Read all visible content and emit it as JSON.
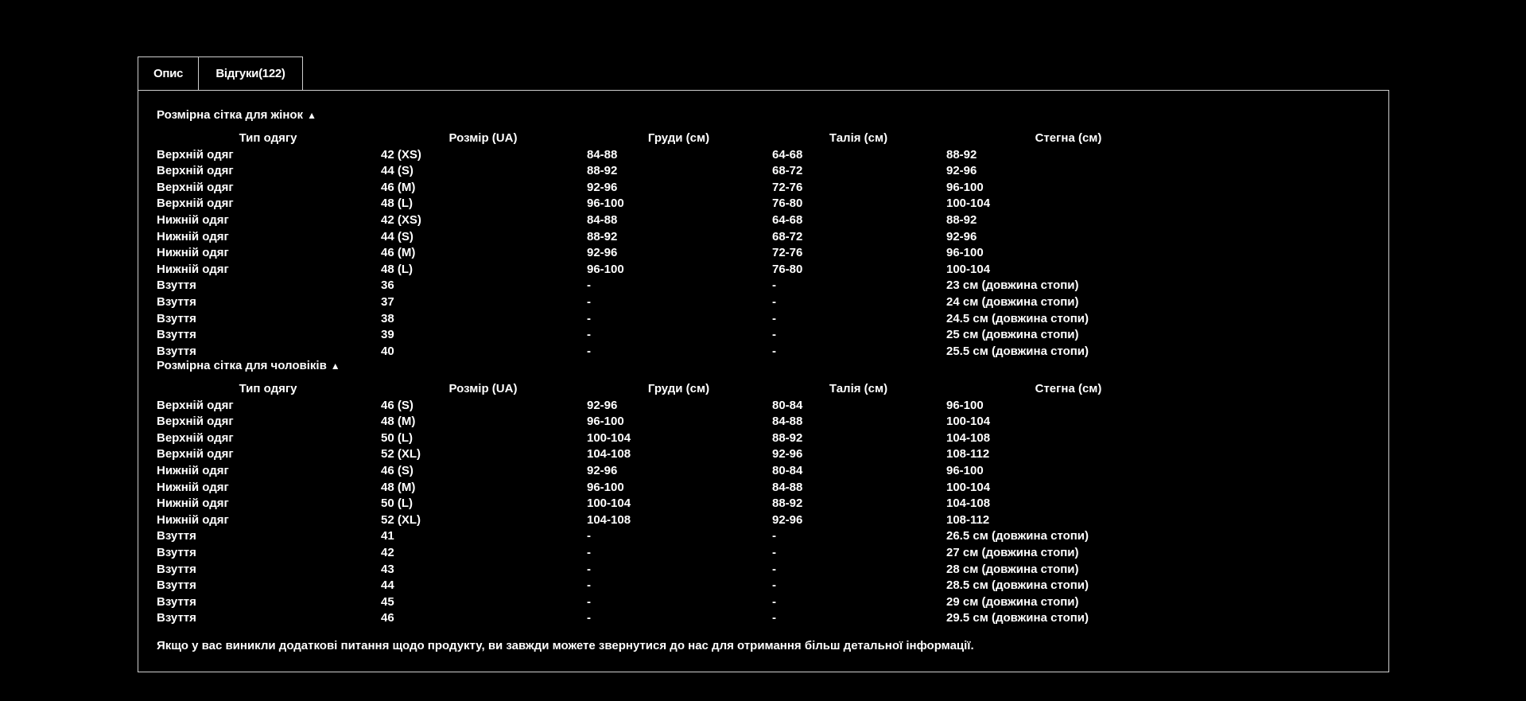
{
  "tabs": [
    {
      "label": "Опис"
    },
    {
      "label": "Відгуки(122)"
    }
  ],
  "women": {
    "title": "Розмірна сітка для жінок",
    "arrow": "▲",
    "headers": [
      "Тип одягу",
      "Розмір (UA)",
      "Груди (см)",
      "Талія (см)",
      "Стегна (см)"
    ],
    "rows": [
      [
        "Верхній одяг",
        "42 (XS)",
        "84-88",
        "64-68",
        "88-92"
      ],
      [
        "Верхній одяг",
        "44 (S)",
        "88-92",
        "68-72",
        "92-96"
      ],
      [
        "Верхній одяг",
        "46 (M)",
        "92-96",
        "72-76",
        "96-100"
      ],
      [
        "Верхній одяг",
        "48 (L)",
        "96-100",
        "76-80",
        "100-104"
      ],
      [
        "Нижній одяг",
        "42 (XS)",
        "84-88",
        "64-68",
        "88-92"
      ],
      [
        "Нижній одяг",
        "44 (S)",
        "88-92",
        "68-72",
        "92-96"
      ],
      [
        "Нижній одяг",
        "46 (M)",
        "92-96",
        "72-76",
        "96-100"
      ],
      [
        "Нижній одяг",
        "48 (L)",
        "96-100",
        "76-80",
        "100-104"
      ],
      [
        "Взуття",
        "36",
        "-",
        "-",
        "23 см (довжина стопи)"
      ],
      [
        "Взуття",
        "37",
        "-",
        "-",
        "24 см (довжина стопи)"
      ],
      [
        "Взуття",
        "38",
        "-",
        "-",
        "24.5 см (довжина стопи)"
      ],
      [
        "Взуття",
        "39",
        "-",
        "-",
        "25 см (довжина стопи)"
      ],
      [
        "Взуття",
        "40",
        "-",
        "-",
        "25.5 см (довжина стопи)"
      ]
    ]
  },
  "men": {
    "title": "Розмірна сітка для чоловіків",
    "arrow": "▲",
    "headers": [
      "Тип одягу",
      "Розмір (UA)",
      "Груди (см)",
      "Талія (см)",
      "Стегна (см)"
    ],
    "rows": [
      [
        "Верхній одяг",
        "46 (S)",
        "92-96",
        "80-84",
        "96-100"
      ],
      [
        "Верхній одяг",
        "48 (M)",
        "96-100",
        "84-88",
        "100-104"
      ],
      [
        "Верхній одяг",
        "50 (L)",
        "100-104",
        "88-92",
        "104-108"
      ],
      [
        "Верхній одяг",
        "52 (XL)",
        "104-108",
        "92-96",
        "108-112"
      ],
      [
        "Нижній одяг",
        "46 (S)",
        "92-96",
        "80-84",
        "96-100"
      ],
      [
        "Нижній одяг",
        "48 (M)",
        "96-100",
        "84-88",
        "100-104"
      ],
      [
        "Нижній одяг",
        "50 (L)",
        "100-104",
        "88-92",
        "104-108"
      ],
      [
        "Нижній одяг",
        "52 (XL)",
        "104-108",
        "92-96",
        "108-112"
      ],
      [
        "Взуття",
        "41",
        "-",
        "-",
        "26.5 см (довжина стопи)"
      ],
      [
        "Взуття",
        "42",
        "-",
        "-",
        "27 см (довжина стопи)"
      ],
      [
        "Взуття",
        "43",
        "-",
        "-",
        "28 см (довжина стопи)"
      ],
      [
        "Взуття",
        "44",
        "-",
        "-",
        "28.5 см (довжина стопи)"
      ],
      [
        "Взуття",
        "45",
        "-",
        "-",
        "29 см (довжина стопи)"
      ],
      [
        "Взуття",
        "46",
        "-",
        "-",
        "29.5 см (довжина стопи)"
      ]
    ]
  },
  "footer_note": "Якщо у вас виникли додаткові питання щодо продукту, ви завжди можете звернутися до нас для отримання більш детальної інформації."
}
